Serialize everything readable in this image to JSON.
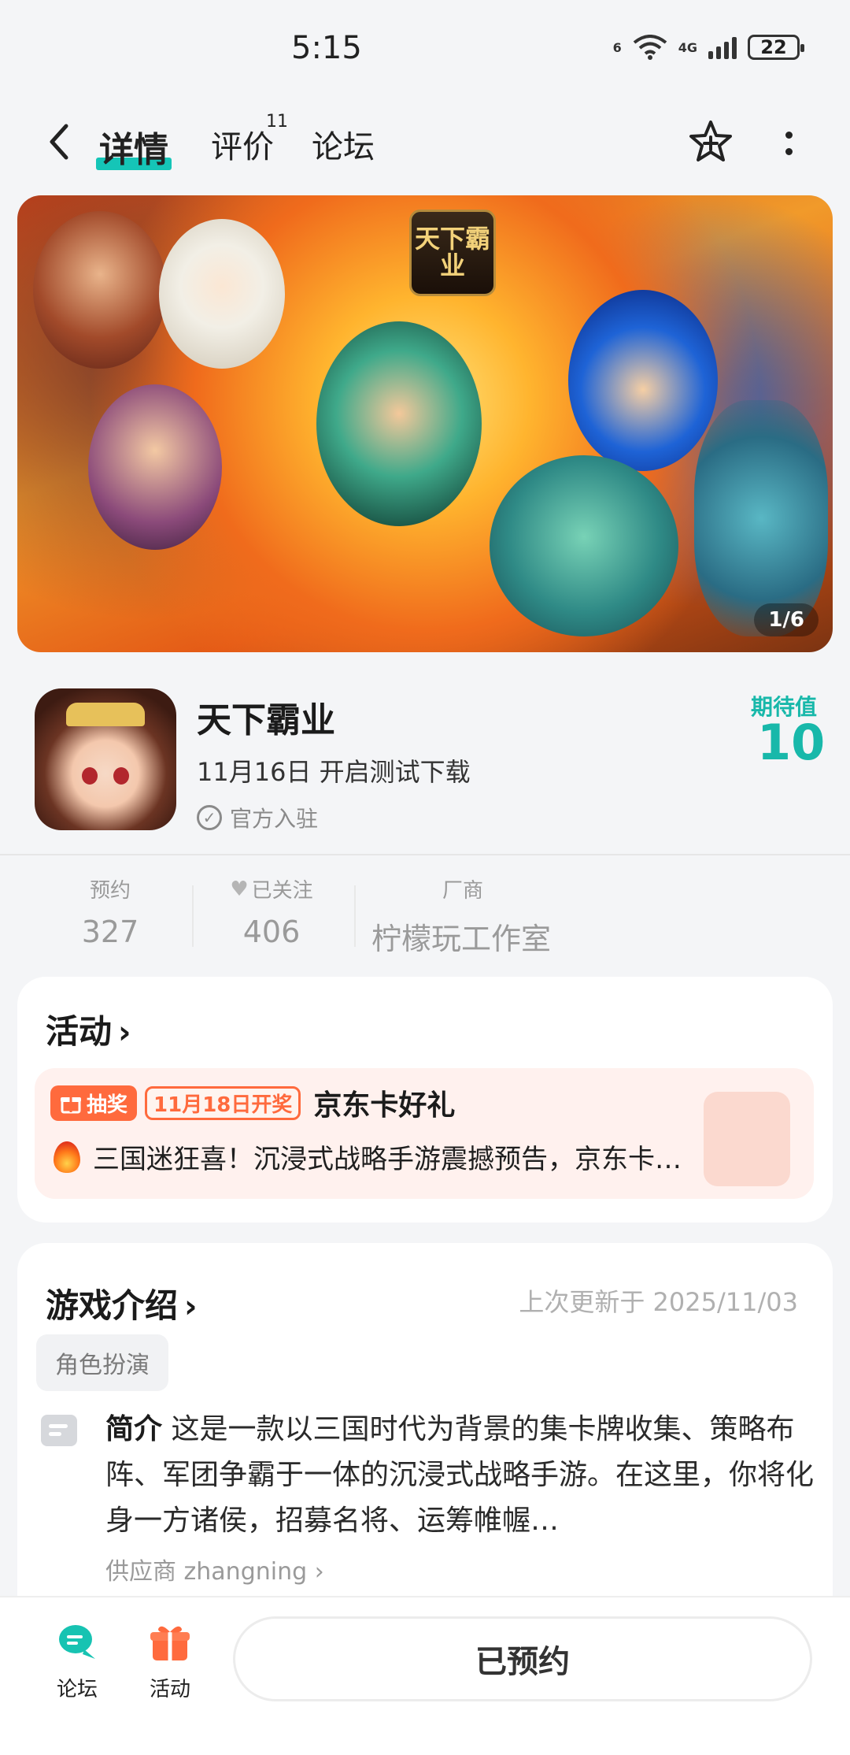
{
  "status_bar": {
    "time": "5:15",
    "battery": "22",
    "network": "4G",
    "wifi_tag": "6"
  },
  "nav": {
    "tabs": [
      {
        "label": "详情"
      },
      {
        "label": "评价",
        "badge": "11"
      },
      {
        "label": "论坛"
      }
    ]
  },
  "banner": {
    "logo_text": "天下霸业",
    "counter": "1/6"
  },
  "game": {
    "title": "天下霸业",
    "subtitle": "11月16日 开启测试下载",
    "official": "官方入驻",
    "expect_label": "期待值",
    "expect_value": "10"
  },
  "stats": {
    "reserve": {
      "label": "预约",
      "value": "327"
    },
    "follow": {
      "label": "已关注",
      "value": "406"
    },
    "vendor": {
      "label": "厂商",
      "value": "柠檬玩工作室"
    }
  },
  "activity": {
    "title": "活动",
    "lottery_label": "抽奖",
    "draw_date": "11月18日开奖",
    "promo_title": "京东卡好礼",
    "promo_desc": "三国迷狂喜！沉浸式战略手游震撼预告，京东卡…"
  },
  "intro": {
    "title": "游戏介绍",
    "updated": "上次更新于 2025/11/03",
    "tag": "角色扮演",
    "label": "简介",
    "text": "这是一款以三国时代为背景的集卡牌收集、策略布阵、军团争霸于一体的沉浸式战略手游。在这里，你将化身一方诸侯，招募名将、运筹帷幄…",
    "provider": "供应商 zhangning"
  },
  "bottom": {
    "forum_label": "论坛",
    "activity_label": "活动",
    "reserve_button": "已预约"
  },
  "colors": {
    "accent": "#15c5b7",
    "promo": "#ff6a3d",
    "promo_bg": "#fff1ee"
  }
}
